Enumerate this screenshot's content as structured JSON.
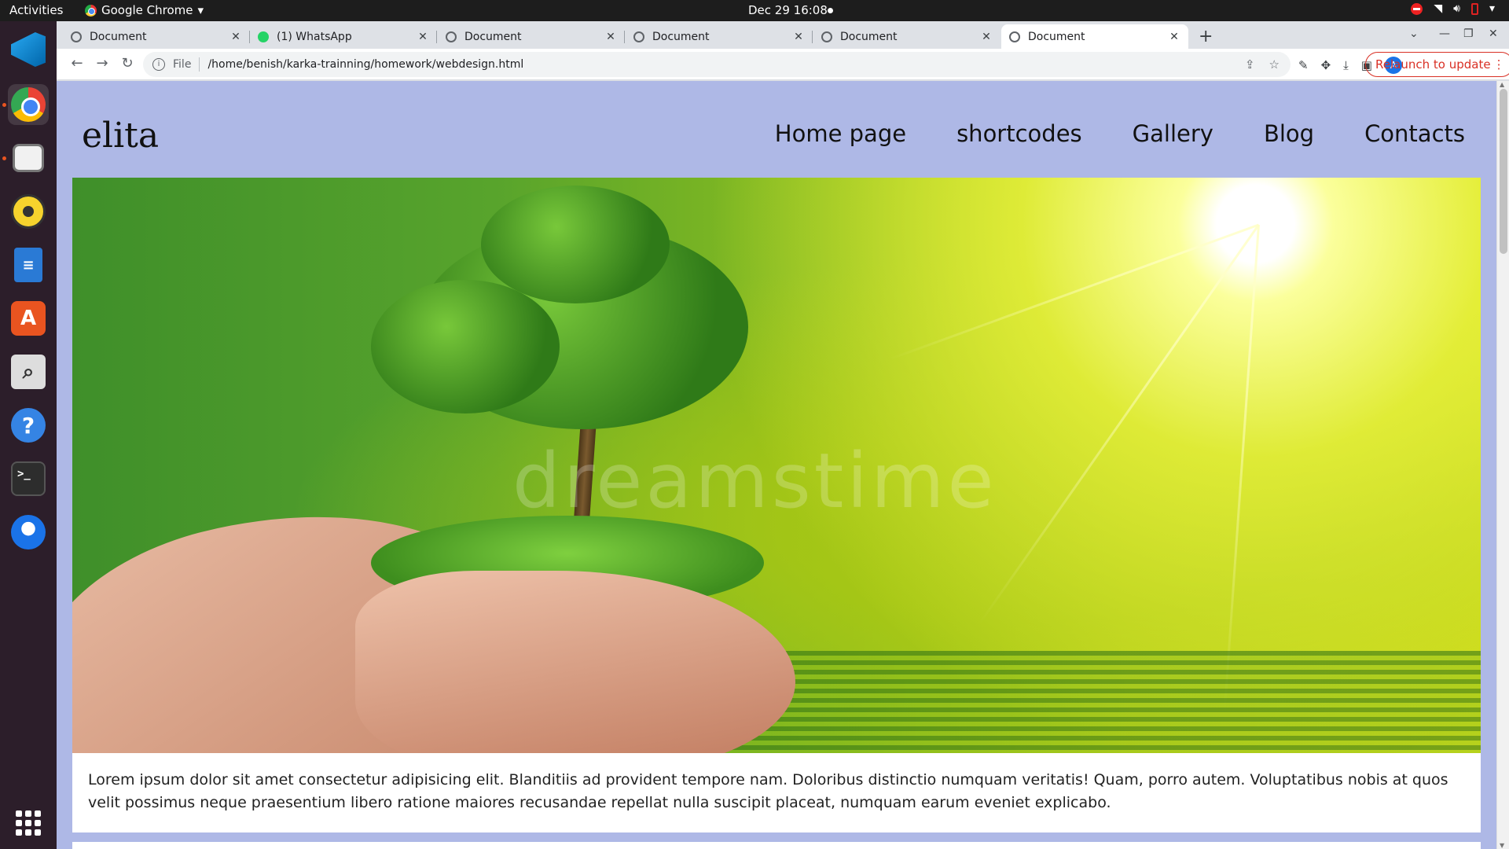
{
  "system": {
    "activities": "Activities",
    "app_name": "Google Chrome",
    "clock": "Dec 29  16:08"
  },
  "dock": {
    "apps": [
      "vscode-icon",
      "chrome-icon",
      "files-icon",
      "rhythmbox-icon",
      "writer-icon",
      "app-store-icon",
      "search-icon",
      "help-icon",
      "terminal-icon",
      "thunderbird-icon",
      "app-grid-icon"
    ],
    "terminal_glyph": ">_"
  },
  "browser": {
    "tabs": [
      {
        "title": "Document"
      },
      {
        "title": "(1) WhatsApp"
      },
      {
        "title": "Document"
      },
      {
        "title": "Document"
      },
      {
        "title": "Document"
      },
      {
        "title": "Document"
      }
    ],
    "active_tab_index": 5,
    "address_scheme": "File",
    "address": "/home/benish/karka-trainning/homework/webdesign.html",
    "relaunch_label": "Relaunch to update",
    "profile_initial": "A"
  },
  "page": {
    "logo": "elita",
    "nav": [
      "Home page",
      "shortcodes",
      "Gallery",
      "Blog",
      "Contacts"
    ],
    "hero_watermark": "dreamstime",
    "paragraph": "Lorem ipsum dolor sit amet consectetur adipisicing elit. Blanditiis ad provident tempore nam. Doloribus distinctio numquam veritatis! Quam, porro autem. Voluptatibus nobis at quos velit possimus neque praesentium libero ratione maiores recusandae repellat nulla suscipit placeat, numquam earum eveniet explicabo."
  },
  "colors": {
    "page_background": "#aeb8e6",
    "relaunch_accent": "#d93025"
  }
}
